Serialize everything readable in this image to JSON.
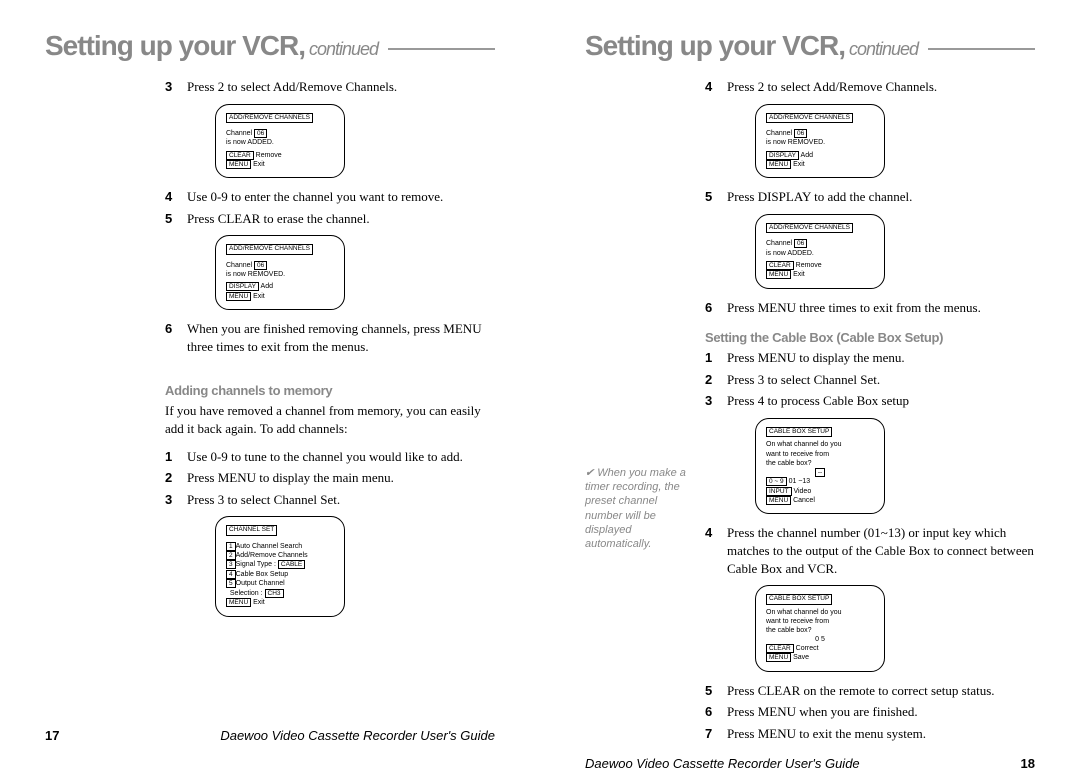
{
  "left": {
    "pageTitle": "Setting up your VCR,",
    "continued": "continued",
    "pageNumber": "17",
    "footerTitle": "Daewoo Video Cassette Recorder User's Guide",
    "steps1": [
      {
        "num": "3",
        "txt": "Press 2 to select Add/Remove Channels."
      }
    ],
    "screen1": {
      "title": "ADD/REMOVE CHANNELS",
      "l1a": "Channel",
      "l1b": "06",
      "l2": "is now ADDED.",
      "l3a": "CLEAR",
      "l3b": " Remove",
      "l4a": "MENU",
      "l4b": " Exit"
    },
    "steps2": [
      {
        "num": "4",
        "txt": "Use 0-9 to enter the channel you want to remove."
      },
      {
        "num": "5",
        "txt": "Press CLEAR to erase the channel."
      }
    ],
    "screen2": {
      "title": "ADD/REMOVE CHANNELS",
      "l1a": "Channel",
      "l1b": "06",
      "l2": "is now REMOVED.",
      "l3a": "DISPLAY",
      "l3b": " Add",
      "l4a": "MENU",
      "l4b": " Exit"
    },
    "steps3": [
      {
        "num": "6",
        "txt": "When you are finished removing channels, press MENU three times to exit from the menus."
      }
    ],
    "subhead1": "Adding channels to memory",
    "intro1": "If you have removed a channel from memory, you can easily add it back again. To add channels:",
    "steps4": [
      {
        "num": "1",
        "txt": "Use 0-9 to tune to the channel you would like to add."
      },
      {
        "num": "2",
        "txt": "Press MENU to display the main menu."
      },
      {
        "num": "3",
        "txt": "Press 3 to select Channel Set."
      }
    ],
    "screen3": {
      "title": "CHANNEL SET",
      "r1a": "1",
      "r1b": "Auto Channel Search",
      "r2a": "2",
      "r2b": "Add/Remove Channels",
      "r3a": "3",
      "r3b": "Signal Type   :",
      "r3c": "CABLE",
      "r4a": "4",
      "r4b": "Cable Box Setup",
      "r5a": "5",
      "r5b": "Output Channel",
      "r6a": "",
      "r6b": "Selection      :",
      "r6c": "CH3",
      "r7a": "MENU",
      "r7b": " Exit"
    }
  },
  "right": {
    "pageTitle": "Setting up your VCR,",
    "continued": "continued",
    "pageNumber": "18",
    "footerTitle": "Daewoo Video Cassette Recorder User's Guide",
    "aside": "When you make a timer recording, the preset channel number will be displayed automatically.",
    "steps1": [
      {
        "num": "4",
        "txt": "Press 2 to select Add/Remove Channels."
      }
    ],
    "screen1": {
      "title": "ADD/REMOVE CHANNELS",
      "l1a": "Channel",
      "l1b": "06",
      "l2": "is now REMOVED.",
      "l3a": "DISPLAY",
      "l3b": " Add",
      "l4a": "MENU",
      "l4b": " Exit"
    },
    "steps2": [
      {
        "num": "5",
        "txt": "Press DISPLAY to add the channel."
      }
    ],
    "screen2": {
      "title": "ADD/REMOVE CHANNELS",
      "l1a": "Channel",
      "l1b": "06",
      "l2": "is now ADDED.",
      "l3a": "CLEAR",
      "l3b": " Remove",
      "l4a": "MENU",
      "l4b": " Exit"
    },
    "steps3": [
      {
        "num": "6",
        "txt": "Press MENU three times to exit from the menus."
      }
    ],
    "subhead1": "Setting the Cable Box (Cable Box Setup)",
    "steps4": [
      {
        "num": "1",
        "txt": "Press MENU to display the menu."
      },
      {
        "num": "2",
        "txt": "Press 3 to select Channel Set."
      },
      {
        "num": "3",
        "txt": "Press 4 to process Cable Box setup"
      }
    ],
    "screen3": {
      "title": "CABLE BOX SETUP",
      "q1": "On what channel do you",
      "q2": "want to receive from",
      "q3": "the cable box?",
      "dash": "--",
      "r1a": "0 ~ 9",
      "r1b": " 01 ~13",
      "r2a": "INPUT",
      "r2b": " Video",
      "r3a": "MENU",
      "r3b": " Cancel"
    },
    "steps5": [
      {
        "num": "4",
        "txt": "Press the channel number (01~13) or input key which matches to the output of the Cable Box to connect between Cable Box and VCR."
      }
    ],
    "screen4": {
      "title": "CABLE BOX SETUP",
      "q1": "On what channel do you",
      "q2": "want to receive from",
      "q3": "the cable box?",
      "val": "0 5",
      "r1a": "CLEAR",
      "r1b": " Correct",
      "r2a": "MENU",
      "r2b": " Save"
    },
    "steps6": [
      {
        "num": "5",
        "txt": "Press CLEAR on the remote to correct setup status."
      },
      {
        "num": "6",
        "txt": "Press MENU when you are finished."
      },
      {
        "num": "7",
        "txt": "Press MENU to exit the menu system."
      }
    ]
  }
}
